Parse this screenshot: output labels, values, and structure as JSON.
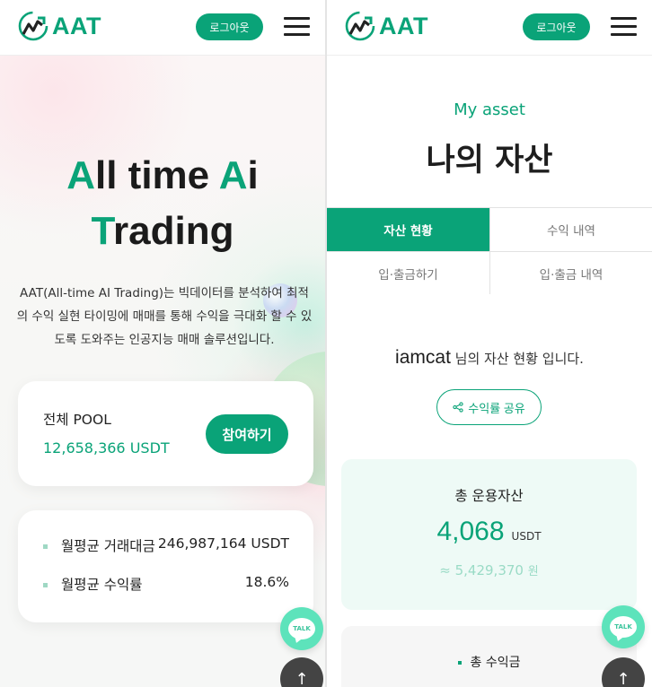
{
  "brand": {
    "name": "AAT",
    "color": "#0aa378",
    "logo_icon": "chart-growth-icon"
  },
  "header": {
    "logout_label": "로그아웃",
    "menu_icon": "hamburger-icon"
  },
  "hero": {
    "title_line1_a": "A",
    "title_line1_b": "ll time ",
    "title_line1_c": "A",
    "title_line1_d": "i",
    "title_line2_a": "T",
    "title_line2_b": "rading",
    "description": "AAT(All-time AI Trading)는 빅데이터를 분석하여 최적의 수익 실현 타이밍에 매매를 통해 수익을 극대화 할 수 있도록 도와주는 인공지능 매매 솔루션입니다."
  },
  "pool": {
    "label": "전체 POOL",
    "value": "12,658,366 USDT",
    "join_label": "참여하기"
  },
  "stats": [
    {
      "label": "월평균 거래대금",
      "value": "246,987,164 USDT"
    },
    {
      "label": "월평균 수익률",
      "value": "18.6%"
    }
  ],
  "floating": {
    "talk_label": "TALK",
    "top_arrow": "↑"
  },
  "asset": {
    "subtitle": "My asset",
    "title": "나의 자산",
    "tabs": [
      "자산 현황",
      "수익 내역",
      "입·출금하기",
      "입·출금 내역"
    ],
    "username": "iamcat",
    "status_suffix": " 님의 자산 현황 입니다.",
    "share_label": "수익률 공유",
    "total_label": "총 운용자산",
    "total_value": "4,068",
    "total_unit": "USDT",
    "krw_value": "≈ 5,429,370",
    "krw_unit": "원",
    "profit_label": "총 수익금"
  }
}
